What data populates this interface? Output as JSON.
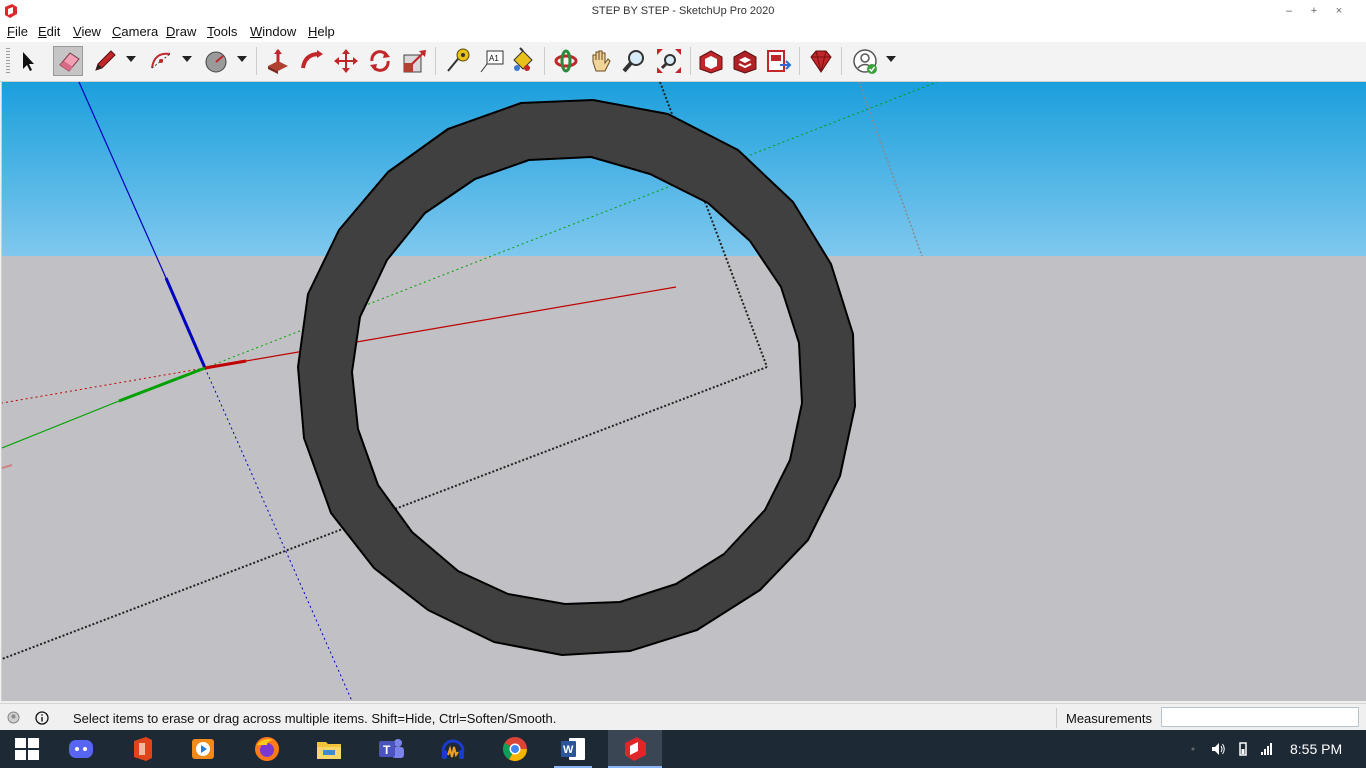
{
  "window": {
    "title": "STEP BY STEP - SketchUp Pro 2020",
    "controls": {
      "minimize": "–",
      "maximize": "+",
      "close": "×"
    }
  },
  "menu": {
    "items": [
      "File",
      "Edit",
      "View",
      "Camera",
      "Draw",
      "Tools",
      "Window",
      "Help"
    ]
  },
  "toolbar": {
    "active_tool": "eraser-tool",
    "tools": [
      "select",
      "eraser",
      "line",
      "arc",
      "shapes",
      "push-pull",
      "follow-me",
      "move",
      "rotate",
      "scale",
      "tape-measure",
      "text",
      "paint-bucket",
      "orbit",
      "pan",
      "zoom",
      "zoom-extents",
      "3d-warehouse",
      "extension-warehouse",
      "layout",
      "extension-manager",
      "account"
    ]
  },
  "statusbar": {
    "message": "Select items to erase or drag across multiple items. Shift=Hide, Ctrl=Soften/Smooth.",
    "measurements_label": "Measurements",
    "measurements_value": ""
  },
  "taskbar": {
    "apps": [
      "start",
      "discord",
      "office",
      "media",
      "firefox",
      "file-explorer",
      "teams",
      "audacity",
      "chrome",
      "word",
      "sketchup"
    ],
    "active_app": "sketchup",
    "clock": "8:55 PM"
  },
  "colors": {
    "sky_top": "#1b9fdc",
    "ground": "#c1c1c5",
    "ring_fill": "#404040",
    "axis_red": "#c00000",
    "axis_green": "#00a000",
    "axis_blue": "#0000c0",
    "taskbar": "#1e2936"
  }
}
